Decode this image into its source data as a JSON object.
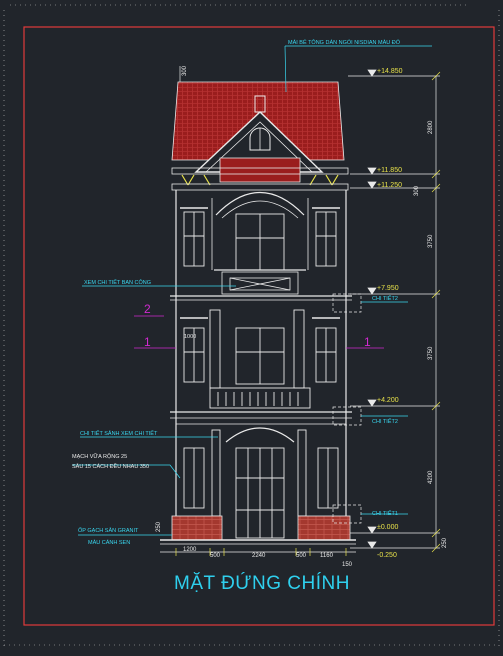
{
  "drawing": {
    "title": "MẶT ĐỨNG CHÍNH",
    "colors": {
      "background": "#21252b",
      "frame": "#e03a3a",
      "lines": "#e9e9e9",
      "annotation": "#39d7f0",
      "dimension": "#e8e24a",
      "roof": "#9a1d1d",
      "brick": "#a4382f",
      "grid_marker": "#d02ad0"
    },
    "notes": {
      "roof_note": "MÁI BÊ TÔNG DÁN NGÓI NISDIAN MÀU ĐỎ",
      "balcony_note": "XEM CHI TIẾT BAN CÔNG",
      "lobby_note": "CHI TIẾT SẢNH XEM CHI TIẾT",
      "joint_note_1": "MẠCH VỮA RỘNG 25",
      "joint_note_2": "SÂU 15 CÁCH ĐỀU NHAU 350",
      "granite_note_1": "ỐP GẠCH SÂN GRANIT",
      "granite_note_2": "MÀU CÁNH SEN",
      "detail_2a": "CHI TIẾT2",
      "detail_2b": "CHI TIẾT2",
      "detail_1": "CHI TIẾT1"
    },
    "grid_markers": [
      "2",
      "1",
      "1"
    ],
    "levels": [
      "+14.850",
      "+11.850",
      "+11.250",
      "+7.950",
      "+4.200",
      "±0.000",
      "-0.250"
    ],
    "vertical_dims": [
      "300",
      "2800",
      "300",
      "3750",
      "3750",
      "4200",
      "250"
    ],
    "horizontal_dims": [
      "1200",
      "500",
      "2240",
      "500",
      "1160",
      "150"
    ],
    "small_labels": [
      "1000"
    ]
  }
}
